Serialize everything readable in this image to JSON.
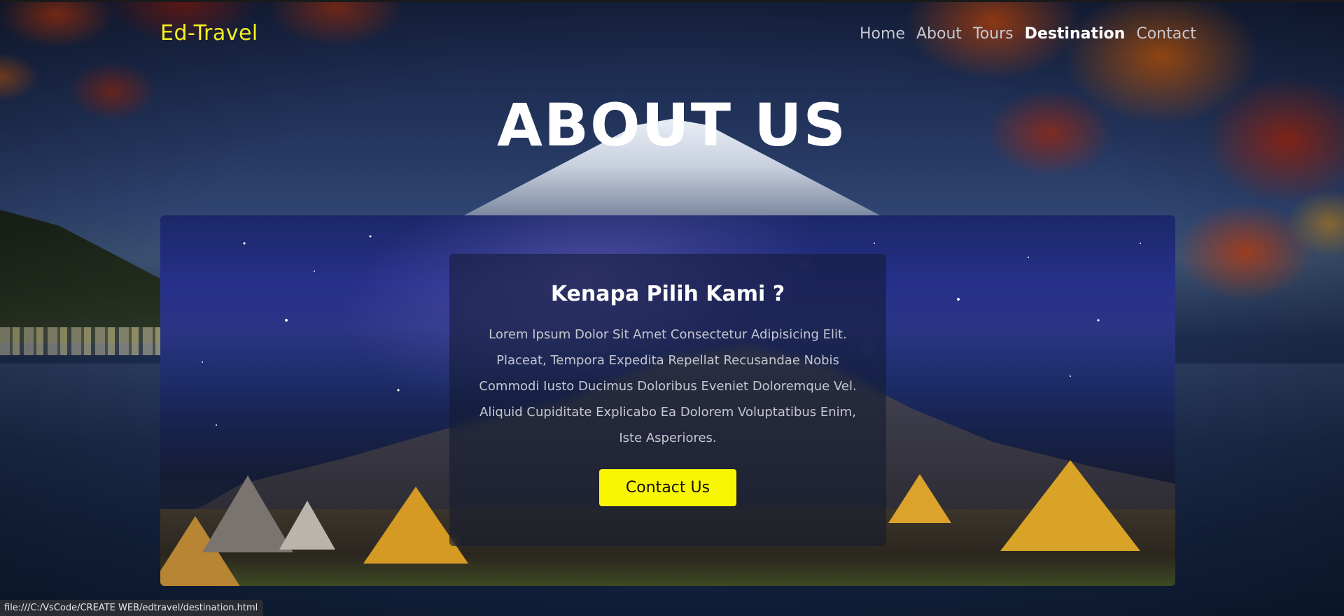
{
  "header": {
    "logo": "Ed-Travel",
    "nav": [
      {
        "label": "Home"
      },
      {
        "label": "About"
      },
      {
        "label": "Tours"
      },
      {
        "label": "Destination"
      },
      {
        "label": "Contact"
      }
    ],
    "active_nav": "Destination"
  },
  "hero": {
    "title": "ABOUT US"
  },
  "card": {
    "title": "Kenapa Pilih Kami ?",
    "text": "Lorem Ipsum Dolor Sit Amet Consectetur Adipisicing Elit. Placeat, Tempora Expedita Repellat Recusandae Nobis Commodi Iusto Ducimus Doloribus Eveniet Doloremque Vel. Aliquid Cupiditate Explicabo Ea Dolorem Voluptatibus Enim, Iste Asperiores.",
    "button_label": "Contact Us"
  },
  "statusbar": {
    "url": "file:///C:/VsCode/CREATE WEB/edtravel/destination.html"
  },
  "colors": {
    "logo": "#f7f01f",
    "button": "#f9f604",
    "active_nav": "#ffffff"
  }
}
